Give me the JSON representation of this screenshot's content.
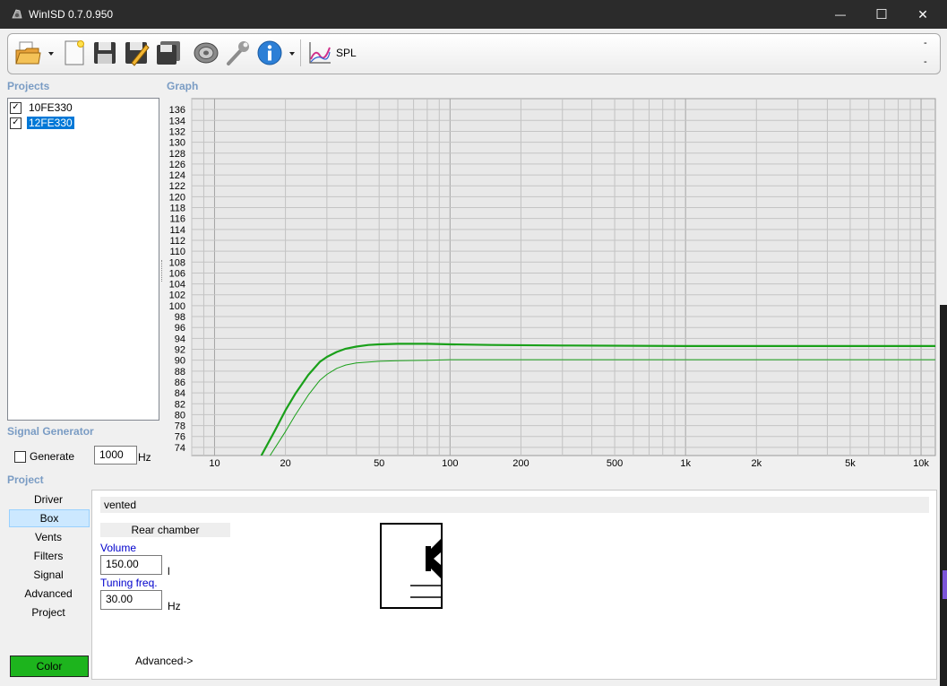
{
  "window": {
    "title": "WinISD 0.7.0.950",
    "minimize_glyph": "—",
    "maximize_glyph": "☐",
    "close_glyph": "✕"
  },
  "toolbar": {
    "icons": [
      "open-folder-icon",
      "new-document-icon",
      "save-icon",
      "save-as-icon",
      "save-all-icon",
      "driver-speaker-icon",
      "tools-wrench-icon",
      "info-icon",
      "spl-graph-icon"
    ],
    "spl_label": "SPL",
    "right_markers": [
      "-",
      "-"
    ]
  },
  "projects": {
    "heading": "Projects",
    "items": [
      {
        "name": "10FE330",
        "checked": true,
        "selected": false
      },
      {
        "name": "12FE330",
        "checked": true,
        "selected": true
      }
    ]
  },
  "graph": {
    "heading": "Graph"
  },
  "chart_data": {
    "type": "line",
    "title": "",
    "xlabel": "",
    "ylabel": "",
    "x_scale": "log",
    "xlim": [
      8,
      11500
    ],
    "ylim": [
      72.5,
      138
    ],
    "grid": true,
    "x_tick_labels": [
      [
        "10",
        10
      ],
      [
        "20",
        20
      ],
      [
        "50",
        50
      ],
      [
        "100",
        100
      ],
      [
        "200",
        200
      ],
      [
        "500",
        500
      ],
      [
        "1k",
        1000
      ],
      [
        "2k",
        2000
      ],
      [
        "5k",
        5000
      ],
      [
        "10k",
        10000
      ]
    ],
    "y_ticks": [
      74,
      76,
      78,
      80,
      82,
      84,
      86,
      88,
      90,
      92,
      94,
      96,
      98,
      100,
      102,
      104,
      106,
      108,
      110,
      112,
      114,
      116,
      118,
      120,
      122,
      124,
      126,
      128,
      130,
      132,
      134,
      136
    ],
    "series": [
      {
        "color": "#1aa01a",
        "stroke": "thick",
        "points": [
          [
            15.8,
            72.5
          ],
          [
            18,
            77
          ],
          [
            20,
            80.8
          ],
          [
            22,
            83.8
          ],
          [
            25,
            87.3
          ],
          [
            28,
            89.7
          ],
          [
            30,
            90.6
          ],
          [
            33,
            91.5
          ],
          [
            36,
            92.1
          ],
          [
            40,
            92.5
          ],
          [
            45,
            92.8
          ],
          [
            50,
            92.9
          ],
          [
            60,
            93.0
          ],
          [
            80,
            93.0
          ],
          [
            100,
            92.9
          ],
          [
            150,
            92.8
          ],
          [
            300,
            92.7
          ],
          [
            1000,
            92.6
          ],
          [
            11500,
            92.6
          ]
        ]
      },
      {
        "color": "#1aa01a",
        "stroke": "thin",
        "points": [
          [
            17.2,
            72.5
          ],
          [
            20,
            76.9
          ],
          [
            22,
            79.9
          ],
          [
            25,
            83.6
          ],
          [
            28,
            86.3
          ],
          [
            30,
            87.4
          ],
          [
            33,
            88.5
          ],
          [
            36,
            89.1
          ],
          [
            40,
            89.5
          ],
          [
            50,
            89.8
          ],
          [
            60,
            89.9
          ],
          [
            80,
            90.0
          ],
          [
            100,
            90.1
          ],
          [
            200,
            90.1
          ],
          [
            1000,
            90.1
          ],
          [
            11500,
            90.1
          ]
        ]
      }
    ]
  },
  "signal_generator": {
    "heading": "Signal Generator",
    "generate_label": "Generate",
    "generate_checked": false,
    "frequency": "1000",
    "unit": "Hz"
  },
  "project_panel": {
    "heading": "Project",
    "nav": [
      "Driver",
      "Box",
      "Vents",
      "Filters",
      "Signal",
      "Advanced",
      "Project"
    ],
    "selected": "Box",
    "color_label": "Color",
    "color_value": "#1db41d"
  },
  "box": {
    "type": "vented",
    "rear_chamber_label": "Rear chamber",
    "volume_label": "Volume",
    "volume_value": "150.00",
    "volume_unit": "l",
    "tuning_label": "Tuning freq.",
    "tuning_value": "30.00",
    "tuning_unit": "Hz",
    "advanced_link": "Advanced->"
  }
}
